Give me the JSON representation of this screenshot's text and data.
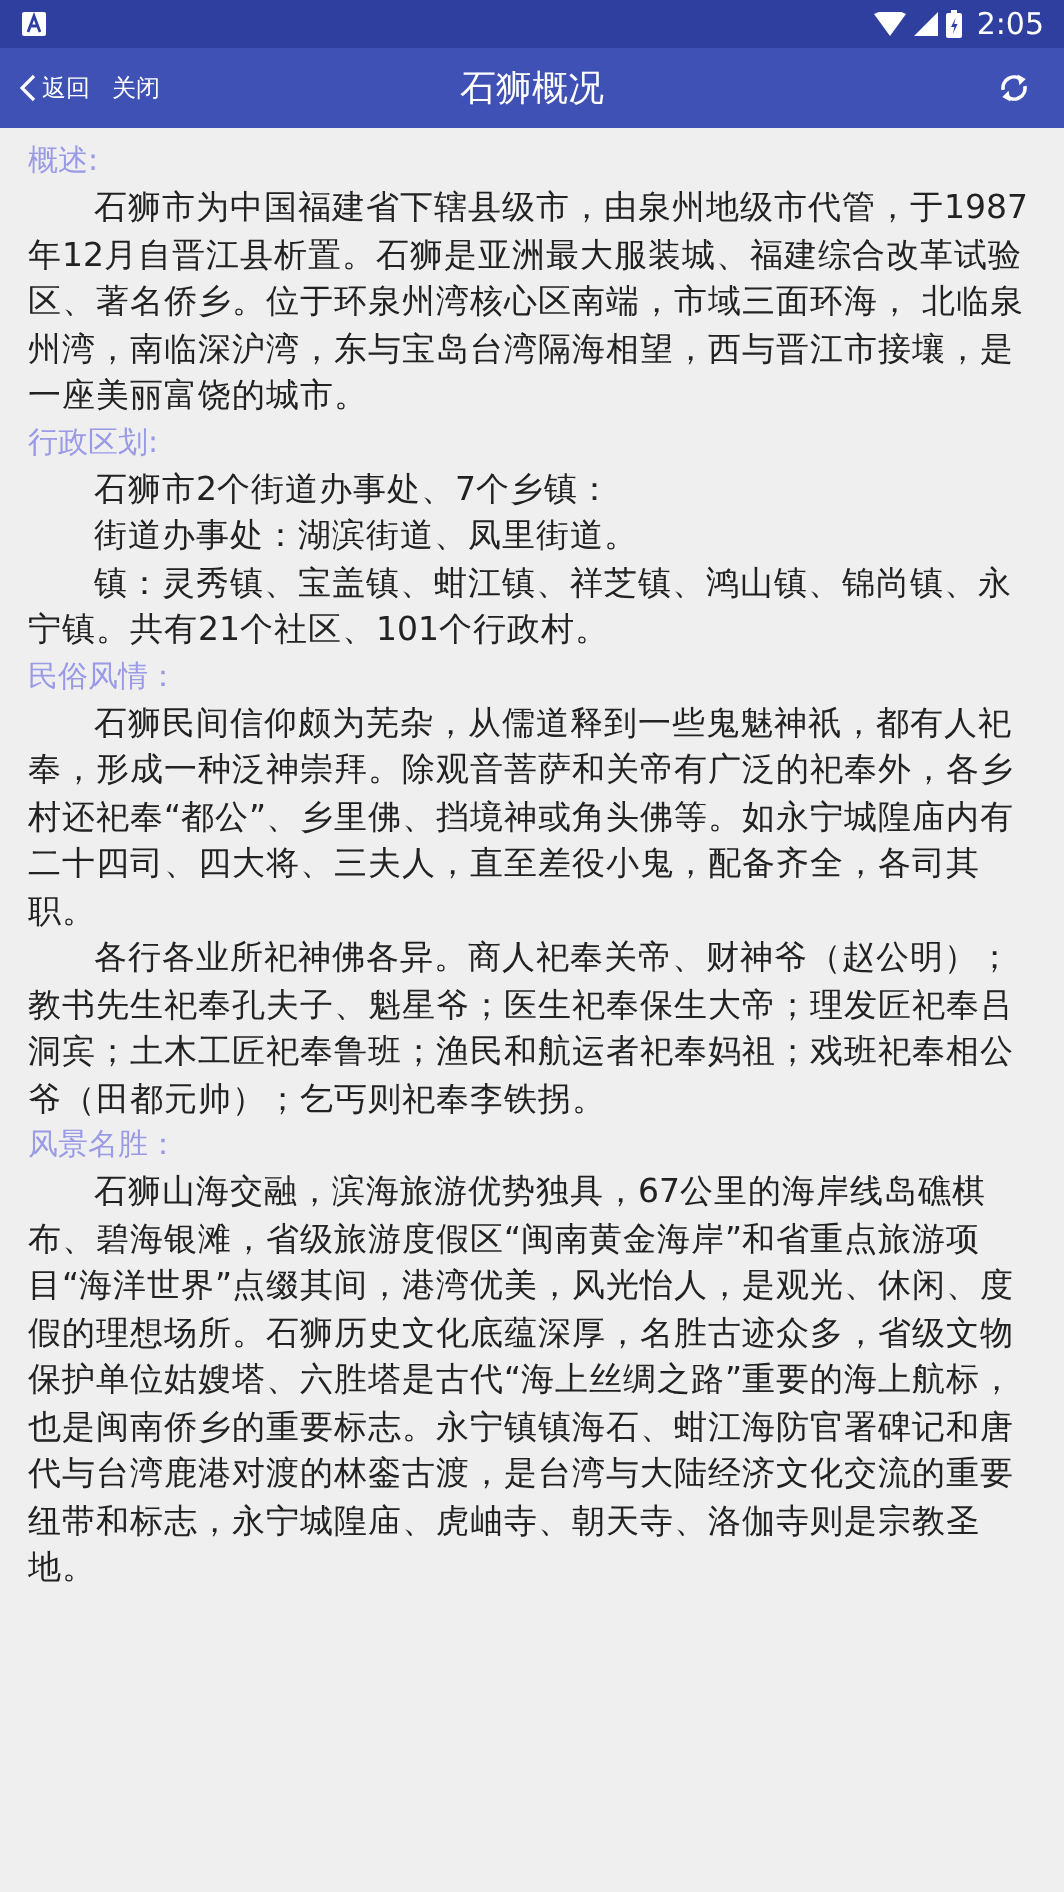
{
  "status_bar": {
    "time": "2:05"
  },
  "header": {
    "back": "返回",
    "close": "关闭",
    "title": "石狮概况"
  },
  "sections": [
    {
      "heading": "概述:",
      "paragraphs": [
        "石狮市为中国福建省下辖县级市，由泉州地级市代管，于1987年12月自晋江县析置。石狮是亚洲最大服装城、福建综合改革试验区、著名侨乡。位于环泉州湾核心区南端，市域三面环海，  北临泉州湾，南临深沪湾，东与宝岛台湾隔海相望，西与晋江市接壤，是一座美丽富饶的城市。"
      ]
    },
    {
      "heading": "行政区划:",
      "paragraphs": [
        "石狮市2个街道办事处、7个乡镇：",
        "街道办事处：湖滨街道、凤里街道。",
        " 镇：灵秀镇、宝盖镇、蚶江镇、祥芝镇、鸿山镇、锦尚镇、永宁镇。共有21个社区、101个行政村。"
      ]
    },
    {
      "heading": "民俗风情：",
      "paragraphs": [
        "石狮民间信仰颇为芜杂，从儒道释到一些鬼魅神祇，都有人祀奉，形成一种泛神崇拜。除观音菩萨和关帝有广泛的祀奉外，各乡村还祀奉“都公”、乡里佛、挡境神或角头佛等。如永宁城隍庙内有二十四司、四大将、三夫人，直至差役小鬼，配备齐全，各司其职。",
        "各行各业所祀神佛各异。商人祀奉关帝、财神爷（赵公明）；教书先生祀奉孔夫子、魁星爷；医生祀奉保生大帝；理发匠祀奉吕洞宾；土木工匠祀奉鲁班；渔民和航运者祀奉妈祖；戏班祀奉相公爷（田都元帅）；乞丐则祀奉李铁拐。"
      ]
    },
    {
      "heading": "风景名胜：",
      "paragraphs": [
        "石狮山海交融，滨海旅游优势独具，67公里的海岸线岛礁棋布、碧海银滩，省级旅游度假区“闽南黄金海岸”和省重点旅游项目“海洋世界”点缀其间，港湾优美，风光怡人，是观光、休闲、度假的理想场所。石狮历史文化底蕴深厚，名胜古迹众多，省级文物保护单位姑嫂塔、六胜塔是古代“海上丝绸之路”重要的海上航标，也是闽南侨乡的重要标志。永宁镇镇海石、蚶江海防官署碑记和唐代与台湾鹿港对渡的林銮古渡，是台湾与大陆经济文化交流的重要纽带和标志，永宁城隍庙、虎岫寺、朝天寺、洛伽寺则是宗教圣地。"
      ]
    }
  ]
}
